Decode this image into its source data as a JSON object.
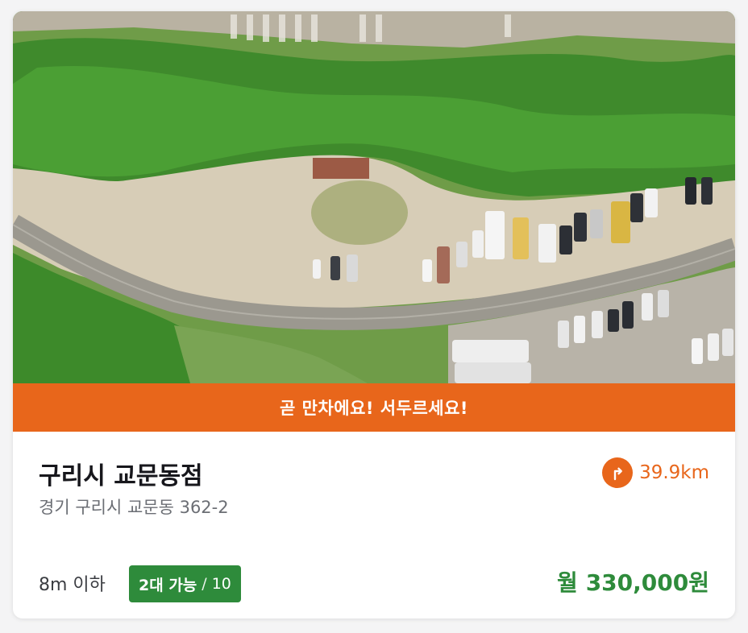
{
  "banner": {
    "text": "곧 만차에요! 서두르세요!"
  },
  "lot": {
    "name": "구리시 교문동점",
    "address": "경기 구리시 교문동 362-2",
    "distance": "39.9km",
    "height_limit": "8m 이하",
    "available": "2대 가능",
    "separator": "/",
    "capacity": "10",
    "price_prefix": "월",
    "price": "330,000원"
  },
  "icons": {
    "direction": "direction-turn-icon"
  },
  "colors": {
    "accent_orange": "#e8661b",
    "available_green": "#2e8b3b",
    "title": "#17171c",
    "muted": "#6b6e74"
  }
}
